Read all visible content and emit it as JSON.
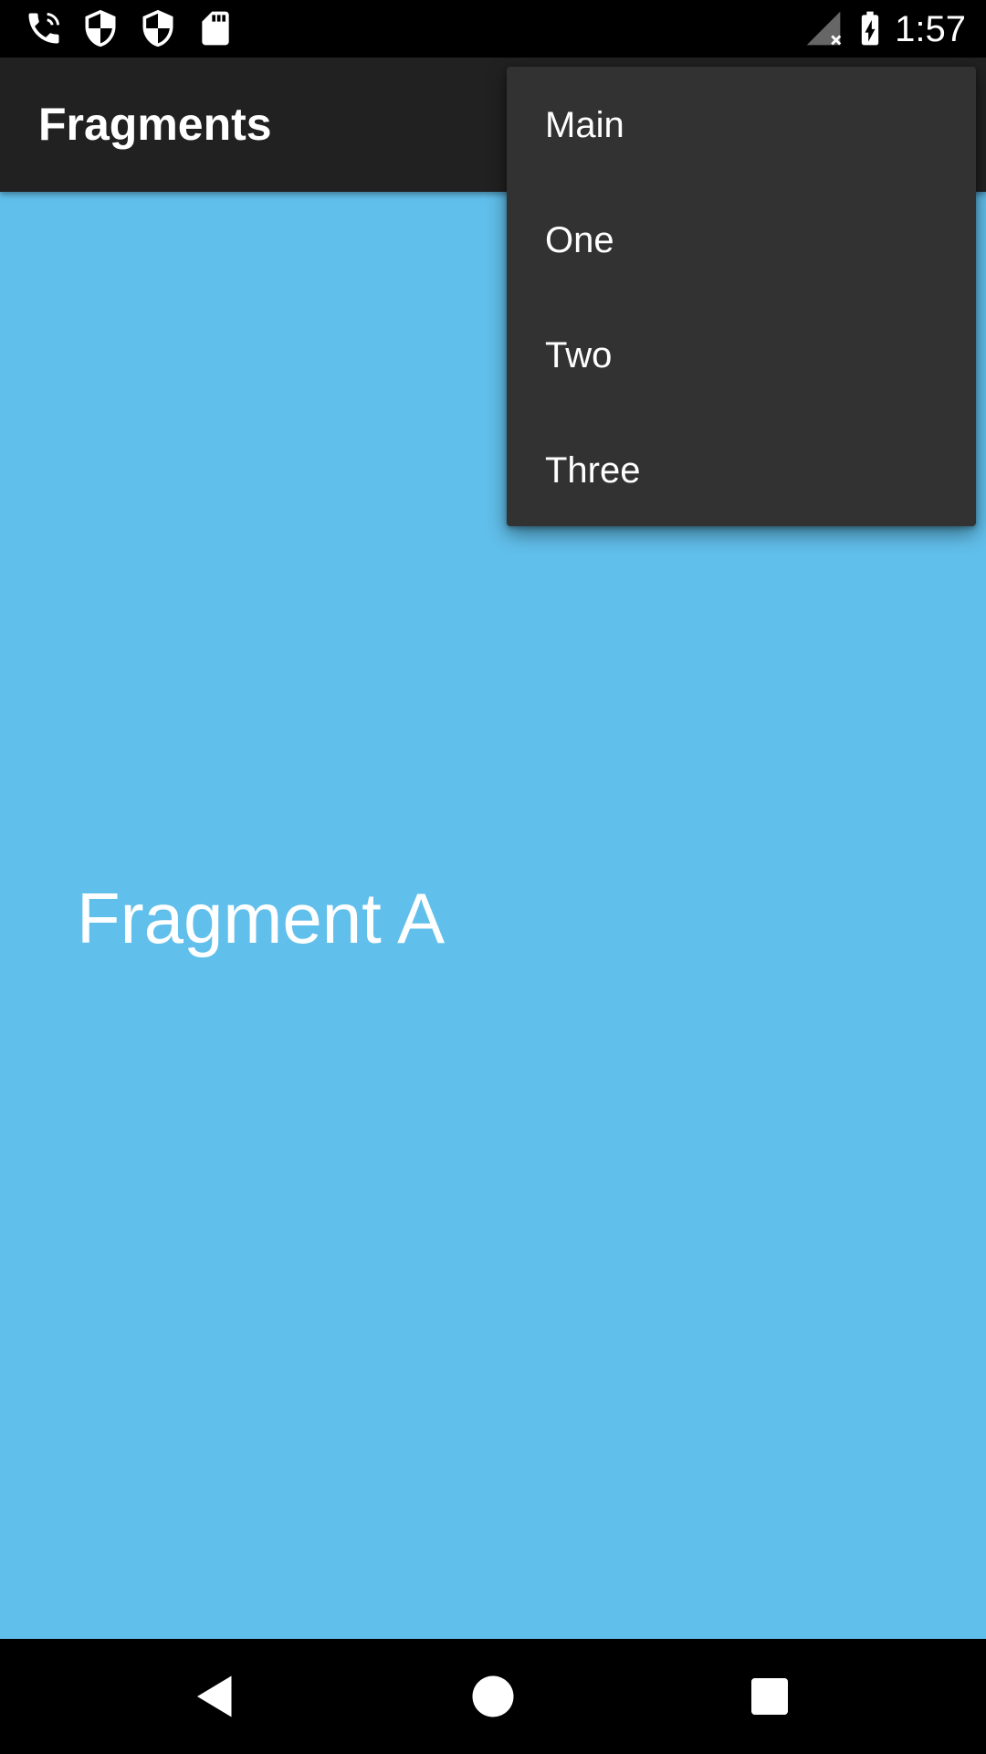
{
  "status_bar": {
    "time": "1:57",
    "icons_left": [
      "wifi-calling-icon",
      "shield-icon",
      "shield-icon",
      "sd-card-icon"
    ],
    "icons_right": [
      "no-signal-icon",
      "battery-charging-icon"
    ]
  },
  "app_bar": {
    "title": "Fragments"
  },
  "menu": {
    "items": [
      {
        "label": "Main"
      },
      {
        "label": "One"
      },
      {
        "label": "Two"
      },
      {
        "label": "Three"
      }
    ]
  },
  "content": {
    "label": "Fragment A",
    "background": "#61bfeb"
  },
  "nav_bar": {
    "buttons": [
      "back-icon",
      "home-icon",
      "recents-icon"
    ]
  },
  "colors": {
    "app_bar": "#212121",
    "menu": "#323232",
    "content": "#61bfeb",
    "text": "#ffffff"
  }
}
